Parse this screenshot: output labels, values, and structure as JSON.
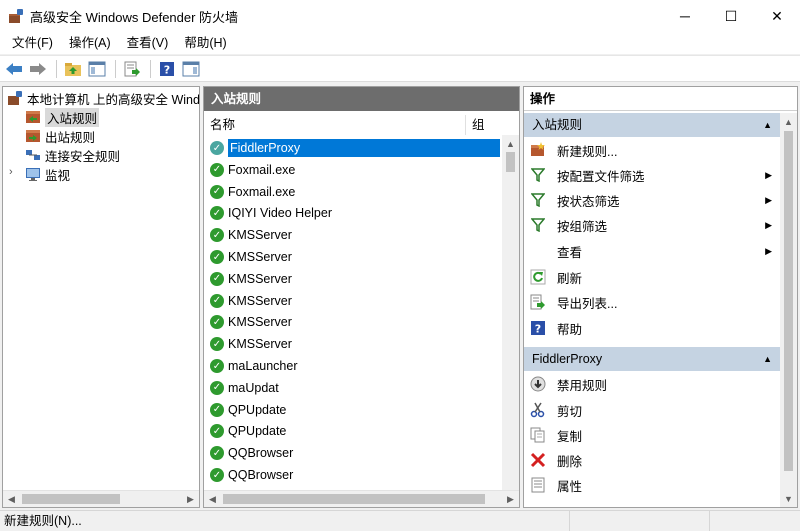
{
  "window": {
    "title": "高级安全 Windows Defender 防火墙",
    "minimize": "─",
    "maximize": "☐",
    "close": "✕"
  },
  "menu": [
    "文件(F)",
    "操作(A)",
    "查看(V)",
    "帮助(H)"
  ],
  "toolbar_icons": [
    "back-arrow-icon",
    "forward-arrow-icon",
    "up-folder-icon",
    "show-hide-console-tree-icon",
    "export-list-icon",
    "help-icon",
    "show-hide-action-pane-icon"
  ],
  "tree": {
    "root": "本地计算机 上的高级安全 Windows Defender 防火墙",
    "items": [
      {
        "label": "入站规则",
        "selected": true
      },
      {
        "label": "出站规则",
        "selected": false
      },
      {
        "label": "连接安全规则",
        "selected": false
      },
      {
        "label": "监视",
        "selected": false
      }
    ]
  },
  "list": {
    "header": "入站规则",
    "columns": {
      "name": "名称",
      "group": "组"
    },
    "rules": [
      "FiddlerProxy",
      "Foxmail.exe",
      "Foxmail.exe",
      "IQIYI Video Helper",
      "KMSServer",
      "KMSServer",
      "KMSServer",
      "KMSServer",
      "KMSServer",
      "KMSServer",
      "maLauncher",
      "maUpdat",
      "QPUpdate",
      "QPUpdate",
      "QQBrowser",
      "QQBrowser"
    ],
    "selected_index": 0
  },
  "actions": {
    "title": "操作",
    "section1": {
      "title": "入站规则",
      "items": [
        {
          "label": "新建规则...",
          "icon": "new-rule-icon",
          "submenu": false
        },
        {
          "label": "按配置文件筛选",
          "icon": "filter-icon",
          "submenu": true
        },
        {
          "label": "按状态筛选",
          "icon": "filter-icon",
          "submenu": true
        },
        {
          "label": "按组筛选",
          "icon": "filter-icon",
          "submenu": true
        },
        {
          "label": "查看",
          "icon": "",
          "submenu": true
        },
        {
          "label": "刷新",
          "icon": "refresh-icon",
          "submenu": false
        },
        {
          "label": "导出列表...",
          "icon": "export-list-icon",
          "submenu": false
        },
        {
          "label": "帮助",
          "icon": "help-icon",
          "submenu": false
        }
      ]
    },
    "section2": {
      "title": "FiddlerProxy",
      "items": [
        {
          "label": "禁用规则",
          "icon": "disable-rule-icon"
        },
        {
          "label": "剪切",
          "icon": "cut-icon"
        },
        {
          "label": "复制",
          "icon": "copy-icon"
        },
        {
          "label": "删除",
          "icon": "delete-icon"
        },
        {
          "label": "属性",
          "icon": "properties-icon"
        }
      ]
    }
  },
  "status": {
    "text": "新建规则(N)..."
  },
  "colors": {
    "selection": "#0078d7",
    "pane_header": "#6d6d6d",
    "section_header": "#c5d3e2",
    "enabled_rule": "#2e9a2e",
    "delete_red": "#d42020"
  }
}
